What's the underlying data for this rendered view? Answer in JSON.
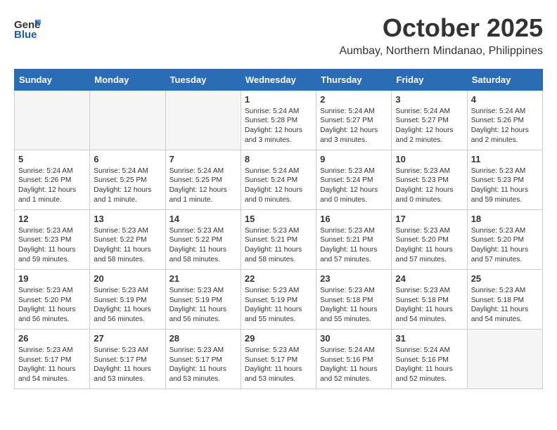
{
  "header": {
    "logo_general": "General",
    "logo_blue": "Blue",
    "month_title": "October 2025",
    "subtitle": "Aumbay, Northern Mindanao, Philippines"
  },
  "weekdays": [
    "Sunday",
    "Monday",
    "Tuesday",
    "Wednesday",
    "Thursday",
    "Friday",
    "Saturday"
  ],
  "weeks": [
    [
      {
        "day": "",
        "info": ""
      },
      {
        "day": "",
        "info": ""
      },
      {
        "day": "",
        "info": ""
      },
      {
        "day": "1",
        "info": "Sunrise: 5:24 AM\nSunset: 5:28 PM\nDaylight: 12 hours\nand 3 minutes."
      },
      {
        "day": "2",
        "info": "Sunrise: 5:24 AM\nSunset: 5:27 PM\nDaylight: 12 hours\nand 3 minutes."
      },
      {
        "day": "3",
        "info": "Sunrise: 5:24 AM\nSunset: 5:27 PM\nDaylight: 12 hours\nand 2 minutes."
      },
      {
        "day": "4",
        "info": "Sunrise: 5:24 AM\nSunset: 5:26 PM\nDaylight: 12 hours\nand 2 minutes."
      }
    ],
    [
      {
        "day": "5",
        "info": "Sunrise: 5:24 AM\nSunset: 5:26 PM\nDaylight: 12 hours\nand 1 minute."
      },
      {
        "day": "6",
        "info": "Sunrise: 5:24 AM\nSunset: 5:25 PM\nDaylight: 12 hours\nand 1 minute."
      },
      {
        "day": "7",
        "info": "Sunrise: 5:24 AM\nSunset: 5:25 PM\nDaylight: 12 hours\nand 1 minute."
      },
      {
        "day": "8",
        "info": "Sunrise: 5:24 AM\nSunset: 5:24 PM\nDaylight: 12 hours\nand 0 minutes."
      },
      {
        "day": "9",
        "info": "Sunrise: 5:23 AM\nSunset: 5:24 PM\nDaylight: 12 hours\nand 0 minutes."
      },
      {
        "day": "10",
        "info": "Sunrise: 5:23 AM\nSunset: 5:23 PM\nDaylight: 12 hours\nand 0 minutes."
      },
      {
        "day": "11",
        "info": "Sunrise: 5:23 AM\nSunset: 5:23 PM\nDaylight: 11 hours\nand 59 minutes."
      }
    ],
    [
      {
        "day": "12",
        "info": "Sunrise: 5:23 AM\nSunset: 5:23 PM\nDaylight: 11 hours\nand 59 minutes."
      },
      {
        "day": "13",
        "info": "Sunrise: 5:23 AM\nSunset: 5:22 PM\nDaylight: 11 hours\nand 58 minutes."
      },
      {
        "day": "14",
        "info": "Sunrise: 5:23 AM\nSunset: 5:22 PM\nDaylight: 11 hours\nand 58 minutes."
      },
      {
        "day": "15",
        "info": "Sunrise: 5:23 AM\nSunset: 5:21 PM\nDaylight: 11 hours\nand 58 minutes."
      },
      {
        "day": "16",
        "info": "Sunrise: 5:23 AM\nSunset: 5:21 PM\nDaylight: 11 hours\nand 57 minutes."
      },
      {
        "day": "17",
        "info": "Sunrise: 5:23 AM\nSunset: 5:20 PM\nDaylight: 11 hours\nand 57 minutes."
      },
      {
        "day": "18",
        "info": "Sunrise: 5:23 AM\nSunset: 5:20 PM\nDaylight: 11 hours\nand 57 minutes."
      }
    ],
    [
      {
        "day": "19",
        "info": "Sunrise: 5:23 AM\nSunset: 5:20 PM\nDaylight: 11 hours\nand 56 minutes."
      },
      {
        "day": "20",
        "info": "Sunrise: 5:23 AM\nSunset: 5:19 PM\nDaylight: 11 hours\nand 56 minutes."
      },
      {
        "day": "21",
        "info": "Sunrise: 5:23 AM\nSunset: 5:19 PM\nDaylight: 11 hours\nand 56 minutes."
      },
      {
        "day": "22",
        "info": "Sunrise: 5:23 AM\nSunset: 5:19 PM\nDaylight: 11 hours\nand 55 minutes."
      },
      {
        "day": "23",
        "info": "Sunrise: 5:23 AM\nSunset: 5:18 PM\nDaylight: 11 hours\nand 55 minutes."
      },
      {
        "day": "24",
        "info": "Sunrise: 5:23 AM\nSunset: 5:18 PM\nDaylight: 11 hours\nand 54 minutes."
      },
      {
        "day": "25",
        "info": "Sunrise: 5:23 AM\nSunset: 5:18 PM\nDaylight: 11 hours\nand 54 minutes."
      }
    ],
    [
      {
        "day": "26",
        "info": "Sunrise: 5:23 AM\nSunset: 5:17 PM\nDaylight: 11 hours\nand 54 minutes."
      },
      {
        "day": "27",
        "info": "Sunrise: 5:23 AM\nSunset: 5:17 PM\nDaylight: 11 hours\nand 53 minutes."
      },
      {
        "day": "28",
        "info": "Sunrise: 5:23 AM\nSunset: 5:17 PM\nDaylight: 11 hours\nand 53 minutes."
      },
      {
        "day": "29",
        "info": "Sunrise: 5:23 AM\nSunset: 5:17 PM\nDaylight: 11 hours\nand 53 minutes."
      },
      {
        "day": "30",
        "info": "Sunrise: 5:24 AM\nSunset: 5:16 PM\nDaylight: 11 hours\nand 52 minutes."
      },
      {
        "day": "31",
        "info": "Sunrise: 5:24 AM\nSunset: 5:16 PM\nDaylight: 11 hours\nand 52 minutes."
      },
      {
        "day": "",
        "info": ""
      }
    ]
  ]
}
